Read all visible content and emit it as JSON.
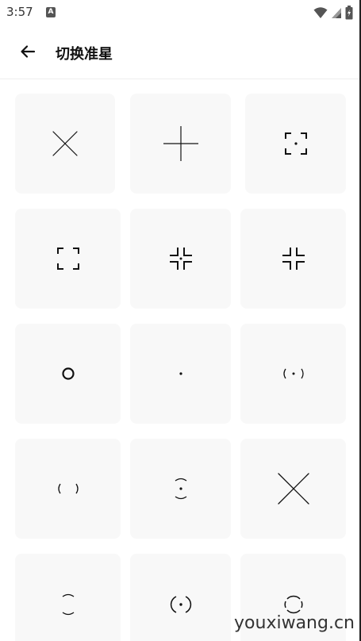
{
  "status_bar": {
    "time": "3:57",
    "app_icon_letter": "A",
    "icons": [
      "wifi-icon",
      "cell-signal-icon",
      "battery-icon"
    ]
  },
  "app_bar": {
    "back_icon": "arrow-left-icon",
    "title": "切换准星"
  },
  "crosshairs": [
    {
      "name": "crosshair-x-thin",
      "icon": "x-cross"
    },
    {
      "name": "crosshair-plus-thin",
      "icon": "plus-cross"
    },
    {
      "name": "crosshair-brackets-dot",
      "icon": "brackets-dot"
    },
    {
      "name": "crosshair-brackets",
      "icon": "brackets"
    },
    {
      "name": "crosshair-inward-corners-dot",
      "icon": "inward-corners-dot"
    },
    {
      "name": "crosshair-inward-corners",
      "icon": "inward-corners"
    },
    {
      "name": "crosshair-circle",
      "icon": "circle"
    },
    {
      "name": "crosshair-dot",
      "icon": "dot"
    },
    {
      "name": "crosshair-parens-dot",
      "icon": "parens-dot"
    },
    {
      "name": "crosshair-parens",
      "icon": "parens"
    },
    {
      "name": "crosshair-arcs-dot",
      "icon": "arcs-dot"
    },
    {
      "name": "crosshair-x-large",
      "icon": "x-large"
    },
    {
      "name": "crosshair-arcs",
      "icon": "arcs"
    },
    {
      "name": "crosshair-circle-dot-broken",
      "icon": "circle-dot-broken"
    },
    {
      "name": "crosshair-circle-broken",
      "icon": "circle-broken"
    }
  ],
  "watermark": "youxiwang.cn"
}
